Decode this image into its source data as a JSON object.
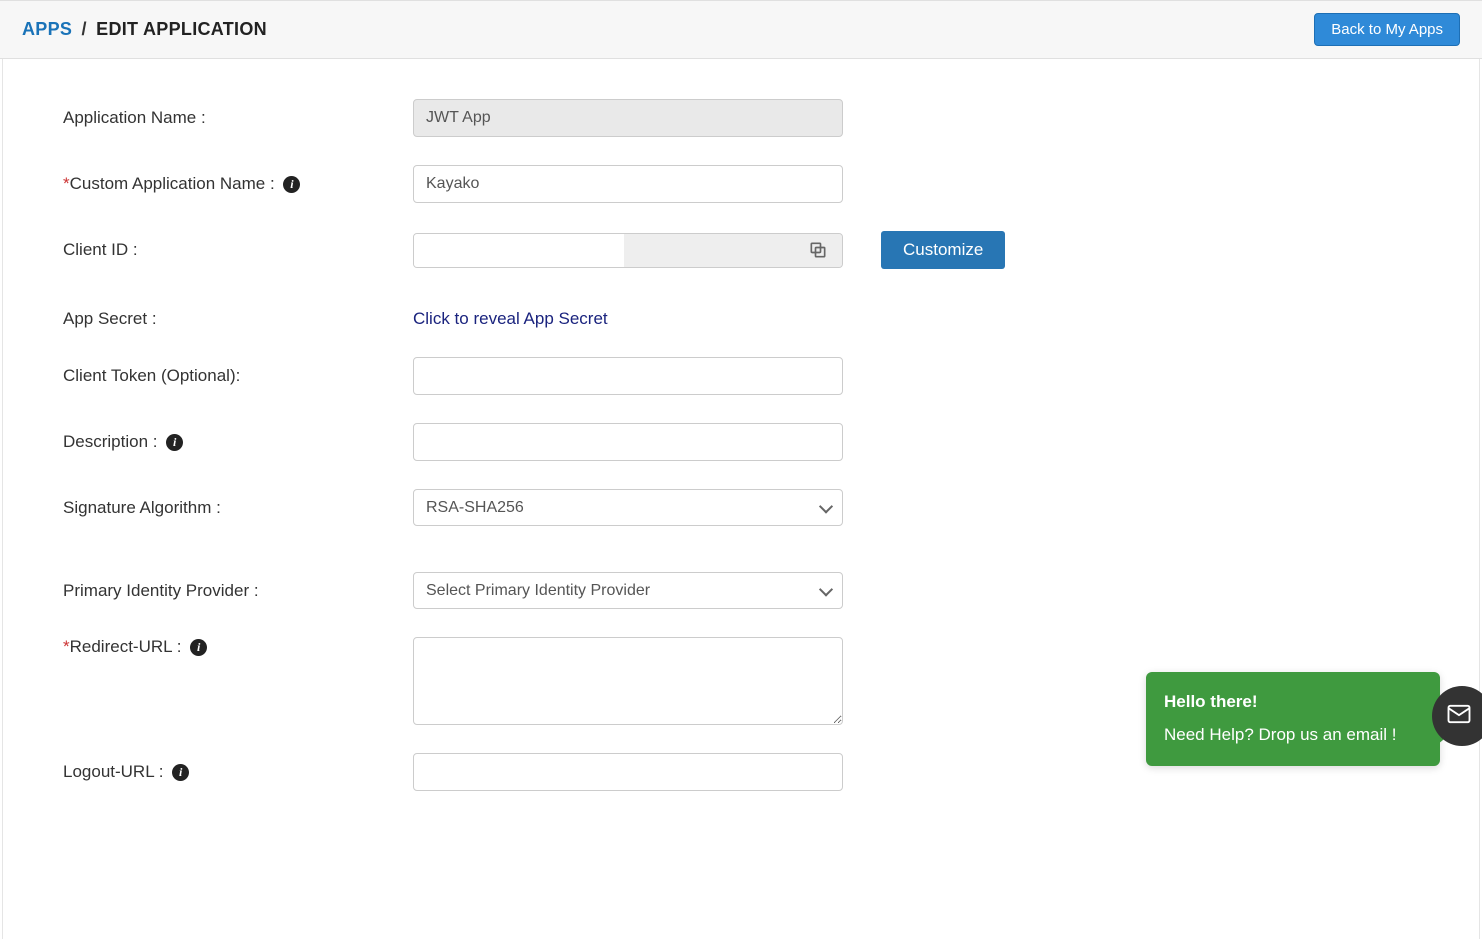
{
  "breadcrumb": {
    "apps": "APPS",
    "separator": "/",
    "current": "EDIT APPLICATION"
  },
  "header": {
    "back_button": "Back to My Apps"
  },
  "form": {
    "app_name": {
      "label": "Application Name :",
      "value": "JWT App"
    },
    "custom_name": {
      "label": "Custom Application Name :",
      "value": "Kayako"
    },
    "client_id": {
      "label": "Client ID :",
      "value": ""
    },
    "customize_button": "Customize",
    "app_secret": {
      "label": "App Secret :",
      "reveal_text": "Click to reveal App Secret"
    },
    "client_token": {
      "label": "Client Token (Optional):",
      "value": ""
    },
    "description": {
      "label": "Description :",
      "value": ""
    },
    "signature_algo": {
      "label": "Signature Algorithm :",
      "selected": "RSA-SHA256"
    },
    "primary_idp": {
      "label": "Primary Identity Provider :",
      "selected": "Select Primary Identity Provider"
    },
    "redirect_url": {
      "label": "Redirect-URL :",
      "value": ""
    },
    "logout_url": {
      "label": "Logout-URL :",
      "value": ""
    }
  },
  "help_widget": {
    "title": "Hello there!",
    "msg": "Need Help? Drop us an email !"
  },
  "required_marker": "*"
}
